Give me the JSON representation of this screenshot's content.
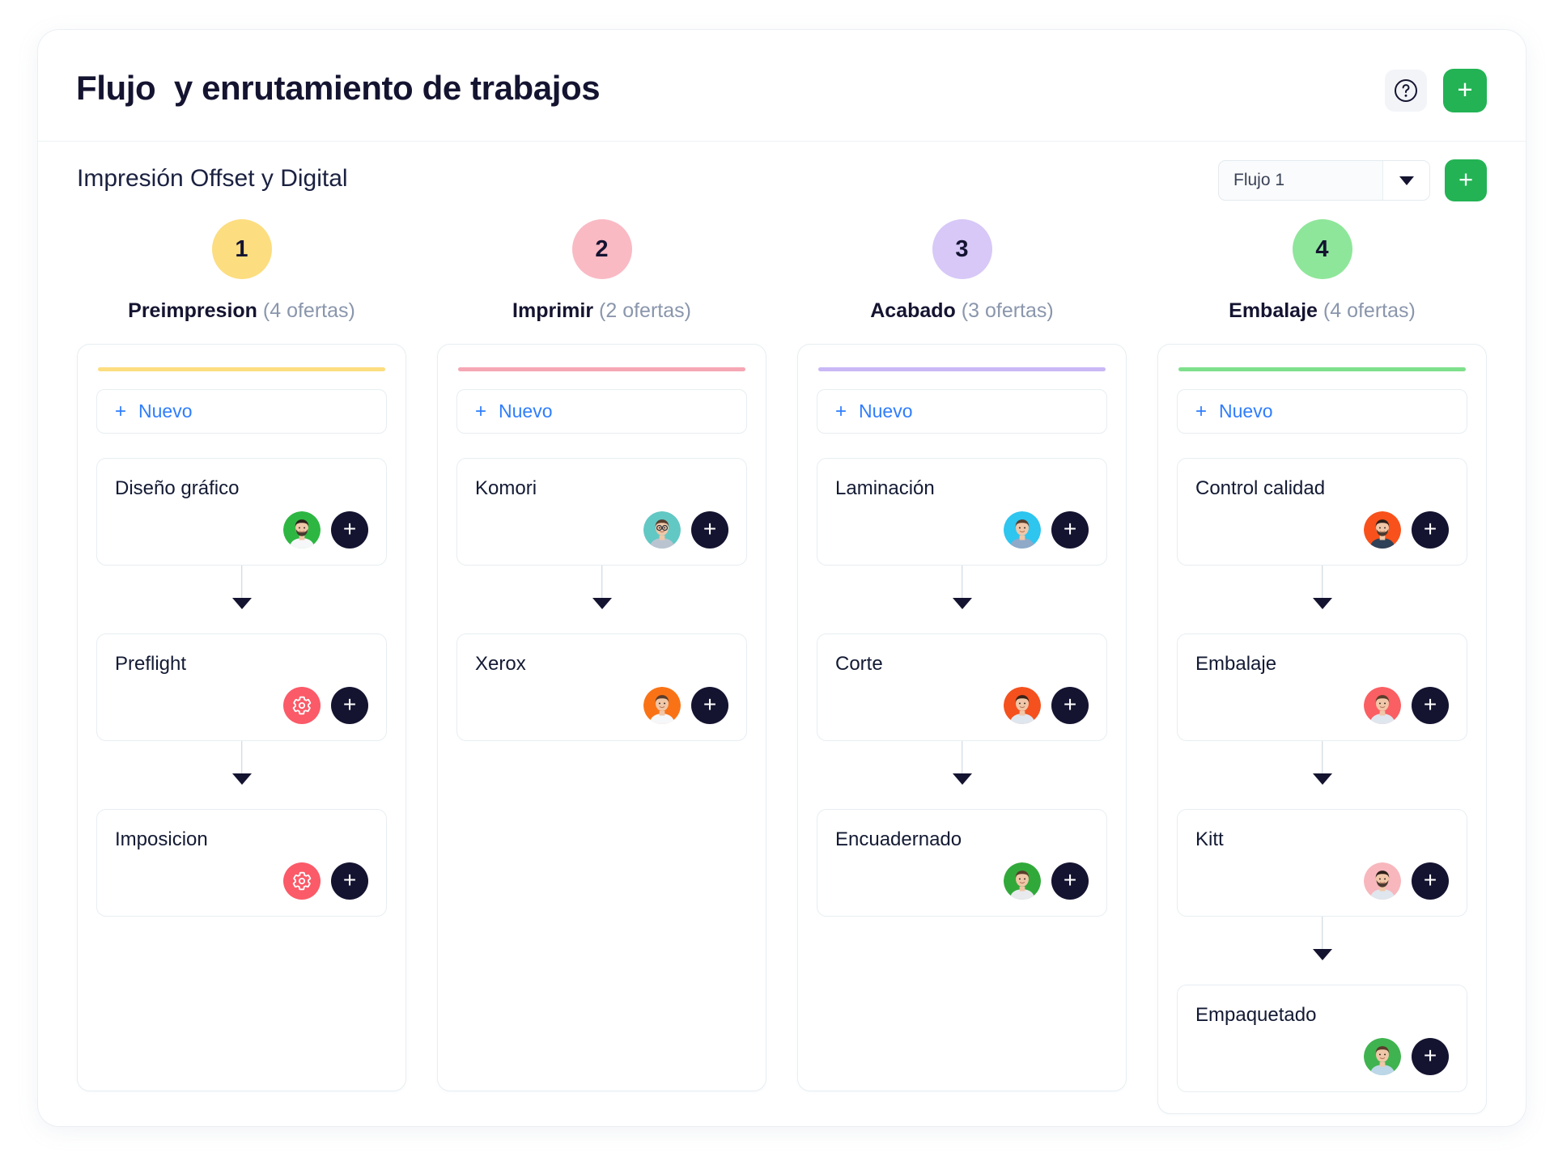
{
  "header": {
    "title": "Flujo  y enrutamiento de trabajos",
    "help_icon": "question-circle-icon",
    "add_label": "+"
  },
  "subheader": {
    "flow_name": "Impresión Offset y Digital",
    "select_value": "Flujo 1",
    "select_caret_icon": "chevron-down-icon",
    "add_label": "+"
  },
  "common": {
    "new_label": "Nuevo",
    "new_plus": "+",
    "add_chip_label": "+",
    "gear_icon": "gear-icon"
  },
  "colors": {
    "step_1": "#fcdd80",
    "step_2": "#f9bac4",
    "step_3": "#d7c8f8",
    "step_4": "#8ee69a",
    "accent_green_button": "#23b354",
    "link_blue": "#2f7dfd",
    "gear_red": "#fb5a68",
    "chip_dark": "#141431"
  },
  "columns": [
    {
      "step": "1",
      "title": "Preimpresion",
      "count": "(4 ofertas)",
      "badge_color": "#fcdd80",
      "accent_color": "#fcdd80",
      "new_label": "Nuevo",
      "nodes": [
        {
          "name": "Diseño gráfico",
          "tool": "avatar",
          "avatar_bg": "#2db742",
          "avatar_kind": "man-beard-white-shirt"
        },
        {
          "name": "Preflight",
          "tool": "gear"
        },
        {
          "name": "Imposicion",
          "tool": "gear"
        }
      ]
    },
    {
      "step": "2",
      "title": "Imprimir",
      "count": "(2 ofertas)",
      "badge_color": "#f9bac4",
      "accent_color": "#f6a7b4",
      "new_label": "Nuevo",
      "nodes": [
        {
          "name": "Komori",
          "tool": "avatar",
          "avatar_bg": "#62c8c4",
          "avatar_kind": "man-glasses-grey-shirt"
        },
        {
          "name": "Xerox",
          "tool": "avatar",
          "avatar_bg": "#f97316",
          "avatar_kind": "man-smiling-white-tee"
        }
      ]
    },
    {
      "step": "3",
      "title": "Acabado",
      "count": "(3 ofertas)",
      "badge_color": "#d7c8f8",
      "accent_color": "#c9b8f5",
      "new_label": "Nuevo",
      "nodes": [
        {
          "name": "Laminación",
          "tool": "avatar",
          "avatar_bg": "#2ec5ef",
          "avatar_kind": "man-denim-shirt"
        },
        {
          "name": "Corte",
          "tool": "avatar",
          "avatar_bg": "#f4511e",
          "avatar_kind": "woman-curly-hair"
        },
        {
          "name": "Encuadernado",
          "tool": "avatar",
          "avatar_bg": "#31a93a",
          "avatar_kind": "man-plaid-shirt"
        }
      ]
    },
    {
      "step": "4",
      "title": "Embalaje",
      "count": "(4 ofertas)",
      "badge_color": "#8ee69a",
      "accent_color": "#7fe08c",
      "new_label": "Nuevo",
      "nodes": [
        {
          "name": "Control calidad",
          "tool": "avatar",
          "avatar_bg": "#f9511b",
          "avatar_kind": "man-beard-jacket"
        },
        {
          "name": "Embalaje",
          "tool": "avatar",
          "avatar_bg": "#fa5f63",
          "avatar_kind": "woman-short-hair"
        },
        {
          "name": "Kitt",
          "tool": "avatar",
          "avatar_bg": "#f7b7bd",
          "avatar_kind": "man-beard-blue-shirt"
        },
        {
          "name": "Empaquetado",
          "tool": "avatar",
          "avatar_bg": "#3fb34f",
          "avatar_kind": "man-light-blue-tee"
        }
      ]
    }
  ]
}
